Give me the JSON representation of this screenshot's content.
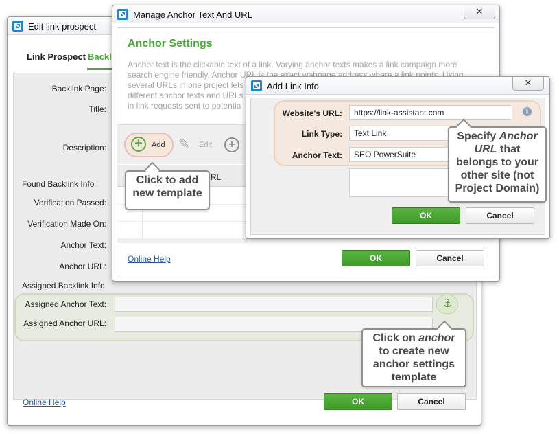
{
  "edit_dialog": {
    "title": "Edit link prospect",
    "tabs": [
      "Link Prospect",
      "Backli"
    ],
    "labels": {
      "backlink_page": "Backlink Page:",
      "title": "Title:",
      "description": "Description:",
      "found_backlink_info": "Found Backlink Info",
      "verification_passed": "Verification Passed:",
      "verification_made_on": "Verification Made On:",
      "anchor_text": "Anchor Text:",
      "anchor_url": "Anchor URL:",
      "assigned_backlink_info": "Assigned Backlink Info",
      "assigned_anchor_text": "Assigned Anchor Text:",
      "assigned_anchor_url": "Assigned Anchor URL:"
    },
    "online_help": "Online Help",
    "ok": "OK",
    "cancel": "Cancel"
  },
  "manage_dialog": {
    "title": "Manage Anchor Text And URL",
    "heading": "Anchor Settings",
    "description_lines": [
      "Anchor text is the clickable text of a link. Varying anchor texts makes a link campaign more",
      "search engine friendly. Anchor URL is the exact webpage address where a link points. Using",
      "several URLs in one project lets",
      "different anchor texts and URLs",
      "in link requests sent to potentia"
    ],
    "toolbar": {
      "add": "Add",
      "edit": "Edit"
    },
    "table_header": "RL",
    "online_help": "Online Help",
    "ok": "OK",
    "cancel": "Cancel"
  },
  "add_link_dialog": {
    "title": "Add Link Info",
    "labels": {
      "website_url": "Website's URL:",
      "link_type": "Link Type:",
      "anchor_text": "Anchor Text:"
    },
    "values": {
      "website_url": "https://link-assistant.com",
      "link_type": "Text Link",
      "anchor_text": "SEO PowerSuite"
    },
    "ok": "OK",
    "cancel": "Cancel"
  },
  "callouts": {
    "add_template": {
      "line1": "Click to add",
      "line2": "new template"
    },
    "anchor_url": {
      "pre": "Specify ",
      "italic1": "Anchor",
      "italic2": "URL",
      "line2": " that",
      "line3": "belongs to your",
      "line4": "other site (not",
      "line5": "Project Domain)"
    },
    "anchor_button": {
      "pre": "Click on ",
      "italic": "anchor",
      "line2": "to create new",
      "line3": "anchor settings",
      "line4": "template"
    }
  },
  "colors": {
    "accent_green": "#4aa835",
    "link_blue": "#1f5aa6",
    "app_icon_blue": "#1f86c8"
  }
}
